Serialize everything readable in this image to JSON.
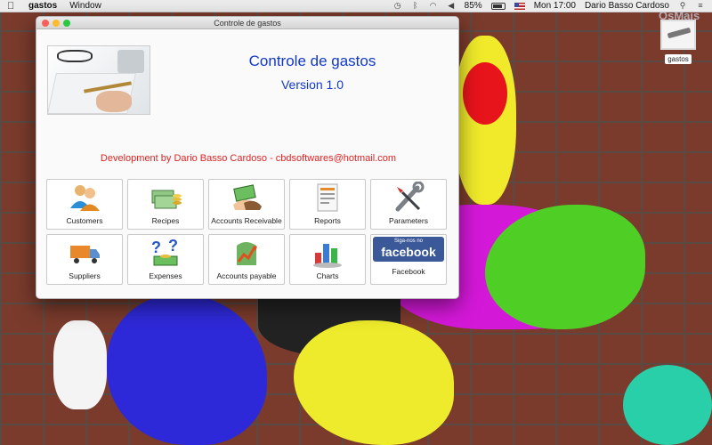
{
  "menubar": {
    "app_name": "gastos",
    "menus": [
      "Window"
    ],
    "battery": "85%",
    "clock": "Mon 17:00",
    "user": "Dario Basso Cardoso"
  },
  "desktop": {
    "icon_label": "gastos",
    "watermark": "OsMais"
  },
  "window": {
    "title": "Controle de gastos",
    "app_title": "Controle de gastos",
    "version": "Version 1.0",
    "credit": "Development by Dario Basso Cardoso - cbdsoftwares@hotmail.com",
    "tiles": [
      {
        "label": "Customers",
        "icon": "customers-icon"
      },
      {
        "label": "Recipes",
        "icon": "recipes-icon"
      },
      {
        "label": "Accounts Receivable",
        "icon": "accounts-receivable-icon"
      },
      {
        "label": "Reports",
        "icon": "reports-icon"
      },
      {
        "label": "Parameters",
        "icon": "parameters-icon"
      },
      {
        "label": "Suppliers",
        "icon": "suppliers-icon"
      },
      {
        "label": "Expenses",
        "icon": "expenses-icon"
      },
      {
        "label": "Accounts payable",
        "icon": "accounts-payable-icon"
      },
      {
        "label": "Charts",
        "icon": "charts-icon"
      },
      {
        "label": "Facebook",
        "icon": "facebook-icon"
      }
    ],
    "facebook_badge": {
      "small": "Siga-nos no",
      "big": "facebook"
    }
  },
  "colors": {
    "title_blue": "#1339c9",
    "credit_red": "#e12323",
    "facebook_blue": "#3b5998"
  }
}
